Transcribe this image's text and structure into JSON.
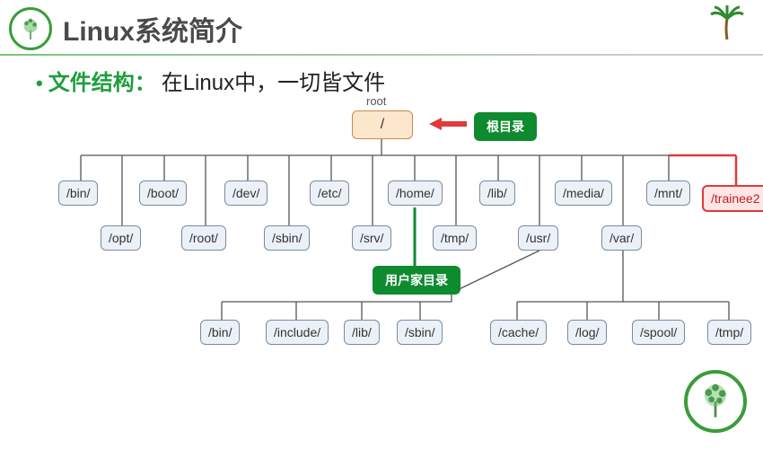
{
  "title": "Linux系统简介",
  "bullet": {
    "label": "文件结构：",
    "text": "在Linux中，一切皆文件"
  },
  "root_label": "root",
  "root_path": "/",
  "tag_root": "根目录",
  "tag_home": "用户家目录",
  "trainee": "/trainee2",
  "row1": [
    "/bin/",
    "/boot/",
    "/dev/",
    "/etc/",
    "/home/",
    "/lib/",
    "/media/",
    "/mnt/"
  ],
  "row2": [
    "/opt/",
    "/root/",
    "/sbin/",
    "/srv/",
    "/tmp/",
    "/usr/",
    "/var/"
  ],
  "usr_children": [
    "/bin/",
    "/include/",
    "/lib/",
    "/sbin/"
  ],
  "var_children": [
    "/cache/",
    "/log/",
    "/spool/",
    "/tmp/"
  ]
}
